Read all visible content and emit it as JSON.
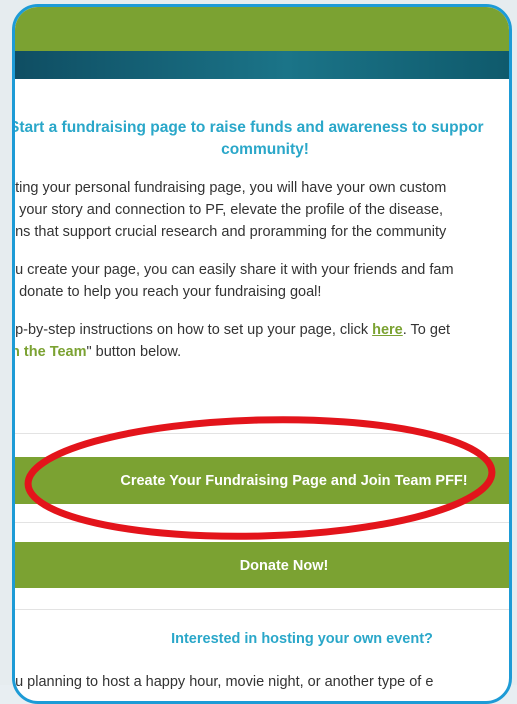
{
  "email": {
    "headline_line1": "Start a fundraising page to raise funds and awareness to suppor",
    "headline_line2": "community!",
    "para1": [
      "ating your personal fundraising page, you will have your own custom",
      "e your story and connection to PF, elevate the profile of the disease,",
      "ons that support crucial research and proramming for the community"
    ],
    "para2": [
      "ou create your page, you can easily share it with your friends and fam",
      "o donate to help you reach your fundraising goal!"
    ],
    "para3": {
      "line1_before": "ep-by-step instructions on how to set up your page, click ",
      "link_text": "here",
      "line1_after": ". To get",
      "line2_team": "in the Team",
      "line2_rest": "\" button below."
    },
    "create_button_label": "Create Your Fundraising Page and Join Team PFF!",
    "donate_button_label": "Donate Now!",
    "subhead": "Interested in hosting your own event?",
    "para4": "ou planning to host a happy hour, movie night, or another type of e"
  },
  "colors": {
    "brand_green": "#7ba232",
    "teal": "#1b7488",
    "heading_blue": "#2aa7c9",
    "frame_blue": "#1d9bd6",
    "annotation_red": "#e3141b"
  }
}
